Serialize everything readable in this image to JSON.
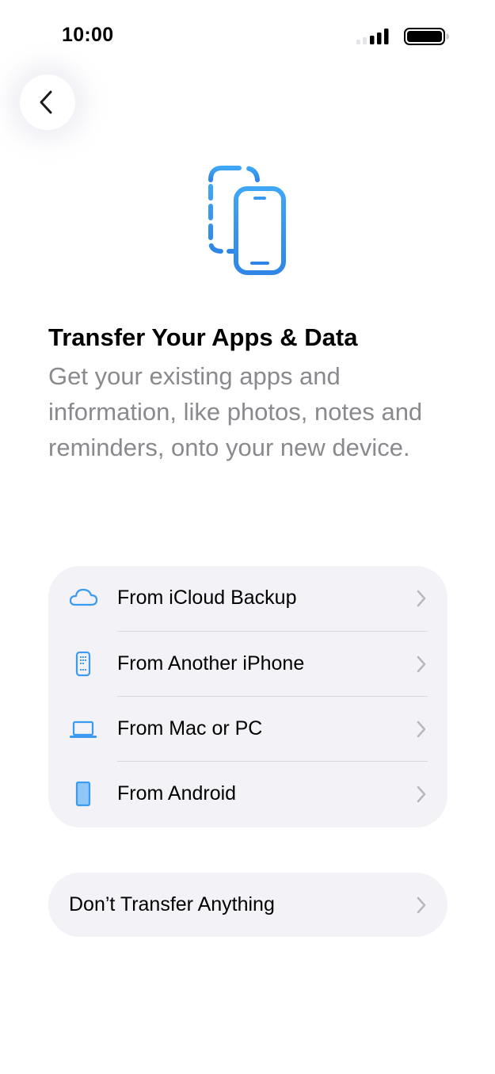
{
  "status_bar": {
    "time": "10:00"
  },
  "back_button": {
    "icon": "chevron-left-icon"
  },
  "hero": {
    "icon": "phone-transfer-icon",
    "accent_color": "#3b9bf0"
  },
  "header": {
    "title": "Transfer Your Apps & Data",
    "subtitle": "Get your existing apps and information, like photos, notes and reminders, onto your new device."
  },
  "options": [
    {
      "label": "From iCloud Backup",
      "icon": "cloud-icon"
    },
    {
      "label": "From Another iPhone",
      "icon": "iphone-icon"
    },
    {
      "label": "From Mac or PC",
      "icon": "laptop-icon"
    },
    {
      "label": "From Android",
      "icon": "android-phone-icon"
    }
  ],
  "skip": {
    "label": "Don’t Transfer Anything"
  },
  "colors": {
    "accent": "#3b9bf0",
    "card_background": "#f2f2f7",
    "secondary_text": "#8a8a8e",
    "chevron": "#b8b8bd"
  }
}
